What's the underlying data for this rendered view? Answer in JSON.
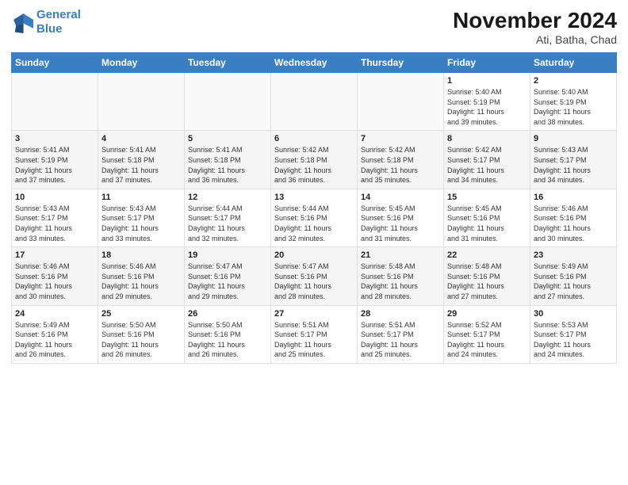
{
  "logo": {
    "line1": "General",
    "line2": "Blue"
  },
  "title": "November 2024",
  "subtitle": "Ati, Batha, Chad",
  "weekdays": [
    "Sunday",
    "Monday",
    "Tuesday",
    "Wednesday",
    "Thursday",
    "Friday",
    "Saturday"
  ],
  "weeks": [
    [
      {
        "day": "",
        "info": ""
      },
      {
        "day": "",
        "info": ""
      },
      {
        "day": "",
        "info": ""
      },
      {
        "day": "",
        "info": ""
      },
      {
        "day": "",
        "info": ""
      },
      {
        "day": "1",
        "info": "Sunrise: 5:40 AM\nSunset: 5:19 PM\nDaylight: 11 hours\nand 39 minutes."
      },
      {
        "day": "2",
        "info": "Sunrise: 5:40 AM\nSunset: 5:19 PM\nDaylight: 11 hours\nand 38 minutes."
      }
    ],
    [
      {
        "day": "3",
        "info": "Sunrise: 5:41 AM\nSunset: 5:19 PM\nDaylight: 11 hours\nand 37 minutes."
      },
      {
        "day": "4",
        "info": "Sunrise: 5:41 AM\nSunset: 5:18 PM\nDaylight: 11 hours\nand 37 minutes."
      },
      {
        "day": "5",
        "info": "Sunrise: 5:41 AM\nSunset: 5:18 PM\nDaylight: 11 hours\nand 36 minutes."
      },
      {
        "day": "6",
        "info": "Sunrise: 5:42 AM\nSunset: 5:18 PM\nDaylight: 11 hours\nand 36 minutes."
      },
      {
        "day": "7",
        "info": "Sunrise: 5:42 AM\nSunset: 5:18 PM\nDaylight: 11 hours\nand 35 minutes."
      },
      {
        "day": "8",
        "info": "Sunrise: 5:42 AM\nSunset: 5:17 PM\nDaylight: 11 hours\nand 34 minutes."
      },
      {
        "day": "9",
        "info": "Sunrise: 5:43 AM\nSunset: 5:17 PM\nDaylight: 11 hours\nand 34 minutes."
      }
    ],
    [
      {
        "day": "10",
        "info": "Sunrise: 5:43 AM\nSunset: 5:17 PM\nDaylight: 11 hours\nand 33 minutes."
      },
      {
        "day": "11",
        "info": "Sunrise: 5:43 AM\nSunset: 5:17 PM\nDaylight: 11 hours\nand 33 minutes."
      },
      {
        "day": "12",
        "info": "Sunrise: 5:44 AM\nSunset: 5:17 PM\nDaylight: 11 hours\nand 32 minutes."
      },
      {
        "day": "13",
        "info": "Sunrise: 5:44 AM\nSunset: 5:16 PM\nDaylight: 11 hours\nand 32 minutes."
      },
      {
        "day": "14",
        "info": "Sunrise: 5:45 AM\nSunset: 5:16 PM\nDaylight: 11 hours\nand 31 minutes."
      },
      {
        "day": "15",
        "info": "Sunrise: 5:45 AM\nSunset: 5:16 PM\nDaylight: 11 hours\nand 31 minutes."
      },
      {
        "day": "16",
        "info": "Sunrise: 5:46 AM\nSunset: 5:16 PM\nDaylight: 11 hours\nand 30 minutes."
      }
    ],
    [
      {
        "day": "17",
        "info": "Sunrise: 5:46 AM\nSunset: 5:16 PM\nDaylight: 11 hours\nand 30 minutes."
      },
      {
        "day": "18",
        "info": "Sunrise: 5:46 AM\nSunset: 5:16 PM\nDaylight: 11 hours\nand 29 minutes."
      },
      {
        "day": "19",
        "info": "Sunrise: 5:47 AM\nSunset: 5:16 PM\nDaylight: 11 hours\nand 29 minutes."
      },
      {
        "day": "20",
        "info": "Sunrise: 5:47 AM\nSunset: 5:16 PM\nDaylight: 11 hours\nand 28 minutes."
      },
      {
        "day": "21",
        "info": "Sunrise: 5:48 AM\nSunset: 5:16 PM\nDaylight: 11 hours\nand 28 minutes."
      },
      {
        "day": "22",
        "info": "Sunrise: 5:48 AM\nSunset: 5:16 PM\nDaylight: 11 hours\nand 27 minutes."
      },
      {
        "day": "23",
        "info": "Sunrise: 5:49 AM\nSunset: 5:16 PM\nDaylight: 11 hours\nand 27 minutes."
      }
    ],
    [
      {
        "day": "24",
        "info": "Sunrise: 5:49 AM\nSunset: 5:16 PM\nDaylight: 11 hours\nand 26 minutes."
      },
      {
        "day": "25",
        "info": "Sunrise: 5:50 AM\nSunset: 5:16 PM\nDaylight: 11 hours\nand 26 minutes."
      },
      {
        "day": "26",
        "info": "Sunrise: 5:50 AM\nSunset: 5:16 PM\nDaylight: 11 hours\nand 26 minutes."
      },
      {
        "day": "27",
        "info": "Sunrise: 5:51 AM\nSunset: 5:17 PM\nDaylight: 11 hours\nand 25 minutes."
      },
      {
        "day": "28",
        "info": "Sunrise: 5:51 AM\nSunset: 5:17 PM\nDaylight: 11 hours\nand 25 minutes."
      },
      {
        "day": "29",
        "info": "Sunrise: 5:52 AM\nSunset: 5:17 PM\nDaylight: 11 hours\nand 24 minutes."
      },
      {
        "day": "30",
        "info": "Sunrise: 5:53 AM\nSunset: 5:17 PM\nDaylight: 11 hours\nand 24 minutes."
      }
    ]
  ]
}
